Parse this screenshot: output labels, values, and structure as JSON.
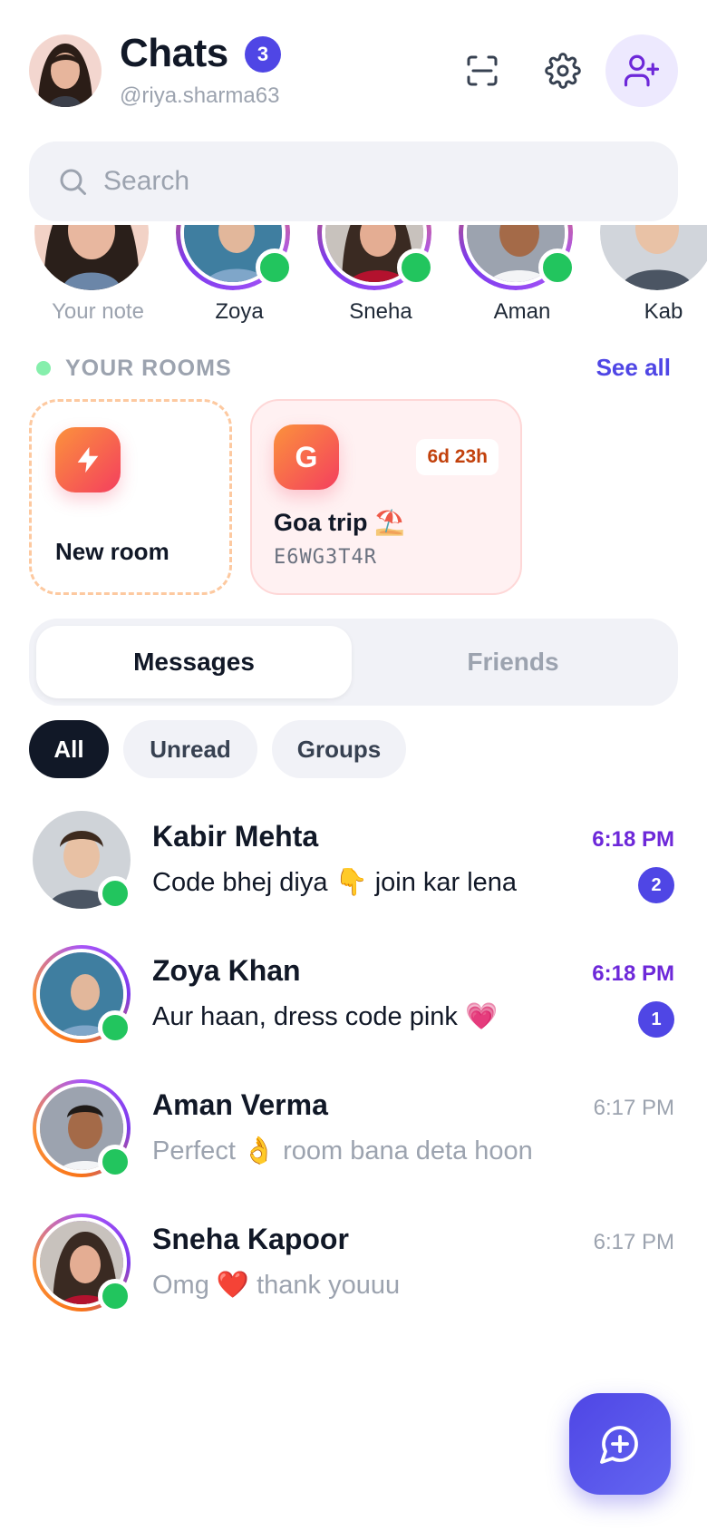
{
  "header": {
    "title": "Chats",
    "unread_count": "3",
    "handle": "@riya.sharma63",
    "avatar_icon": "profile-photo"
  },
  "search": {
    "placeholder": "Search",
    "value": ""
  },
  "stories": [
    {
      "label": "Your note",
      "online": false
    },
    {
      "label": "Zoya",
      "online": true
    },
    {
      "label": "Sneha",
      "online": true
    },
    {
      "label": "Aman",
      "online": true
    },
    {
      "label": "Kab",
      "online": false
    }
  ],
  "rooms": {
    "title": "YOUR ROOMS",
    "see_all": "See all",
    "new_room_label": "New room",
    "items": [
      {
        "initial": "G",
        "name": "Goa trip ⛱️",
        "code": "E6WG3T4R",
        "timer": "6d 23h"
      }
    ]
  },
  "segmented": {
    "active": "Messages",
    "inactive": "Friends"
  },
  "filters": [
    "All",
    "Unread",
    "Groups"
  ],
  "chats": [
    {
      "name": "Kabir Mehta",
      "message": "Code bhej diya 👇  join kar lena",
      "time": "6:18 PM",
      "unread": "2"
    },
    {
      "name": "Zoya Khan",
      "message": "Aur haan, dress code pink 💗",
      "time": "6:18 PM",
      "unread": "1"
    },
    {
      "name": "Aman Verma",
      "message": "Perfect 👌  room bana deta hoon",
      "time": "6:17 PM",
      "unread": ""
    },
    {
      "name": "Sneha Kapoor",
      "message": "Omg ❤️  thank youuu",
      "time": "6:17 PM",
      "unread": ""
    }
  ],
  "colors": {
    "accent": "#4f46e5",
    "online": "#22c55e",
    "room_gradient_start": "#fb923c",
    "room_gradient_end": "#f43f5e"
  }
}
